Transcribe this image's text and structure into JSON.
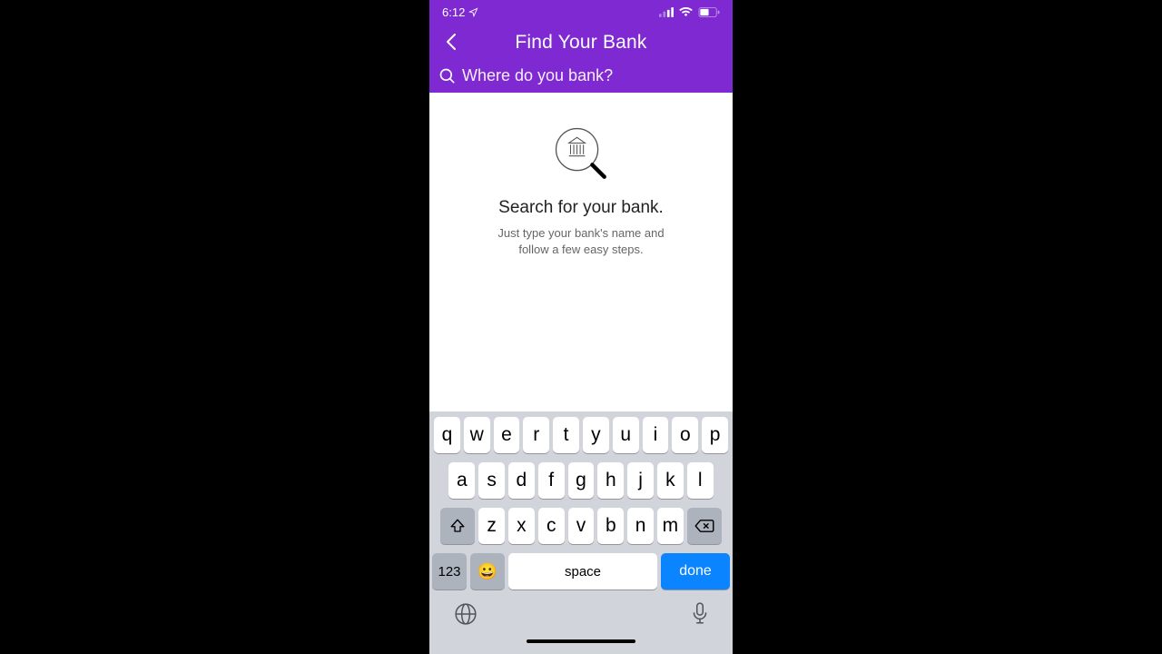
{
  "status": {
    "time": "6:12",
    "location_icon": "location-arrow"
  },
  "header": {
    "title": "Find Your Bank",
    "search_placeholder": "Where do you bank?"
  },
  "empty_state": {
    "title": "Search for your bank.",
    "subtitle": "Just type your bank's name and follow a few easy steps."
  },
  "keyboard": {
    "row1": [
      "q",
      "w",
      "e",
      "r",
      "t",
      "y",
      "u",
      "i",
      "o",
      "p"
    ],
    "row2": [
      "a",
      "s",
      "d",
      "f",
      "g",
      "h",
      "j",
      "k",
      "l"
    ],
    "row3": [
      "z",
      "x",
      "c",
      "v",
      "b",
      "n",
      "m"
    ],
    "num_label": "123",
    "space_label": "space",
    "done_label": "done"
  }
}
